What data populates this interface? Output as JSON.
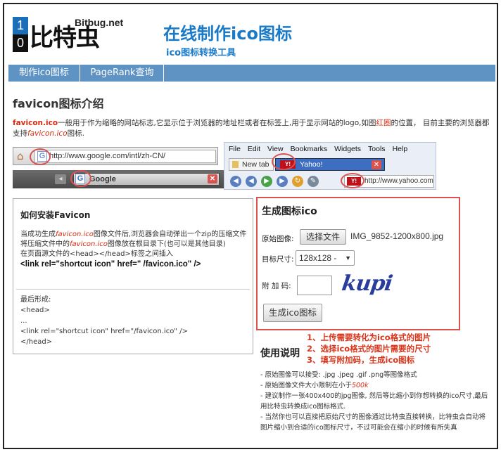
{
  "logo": {
    "digit_top": "1",
    "digit_bottom": "0",
    "text": "比特虫",
    "domain": "Bitbug.net"
  },
  "header": {
    "title": "在线制作ico图标",
    "subtitle": "ico图标转换工具"
  },
  "nav": {
    "items": [
      "制作ico图标",
      "PageRank查询"
    ]
  },
  "intro": {
    "title": "favicon图标介绍",
    "p_lead": "favicon.ico",
    "p_mid": "一般用于作为缩略的网站标志,它显示位于浏览器的地址栏或者在标签上,用于显示网站的logo,如图",
    "p_red": "红圈",
    "p_tail": "的位置， 目前主要的浏览器都支持",
    "p_ital": "favicon.ico",
    "p_end": "图标."
  },
  "browser1": {
    "url": "http://www.google.com/intl/zh-CN/",
    "tab_title": "Google",
    "g": "G"
  },
  "browser2": {
    "menu": [
      "File",
      "Edit",
      "View",
      "Bookmarks",
      "Widgets",
      "Tools",
      "Help"
    ],
    "tab1": "New tab",
    "tab2": "Yahoo!",
    "yicon": "Y!",
    "url": "http://www.yahoo.com"
  },
  "howto": {
    "title": "如何安装Favicon",
    "l1a": "当成功生成",
    "l1b": "favicon.ico",
    "l1c": "图像文件后,浏览器会自动弹出一个zip的压缩文件",
    "l2a": "将压缩文件中的",
    "l2b": "favicon.ico",
    "l2c": "图像放在根目录下(也可以是其他目录)",
    "l3": "在页面源文件的<head></head>标签之间插入",
    "code": "<link rel=\"shortcut icon\" href=\" /favicon.ico\" />",
    "r1": "最后形成:",
    "r2": "<head>",
    "r3": "...",
    "r4": "<link rel=\"shortcut icon\" href=\"/favicon.ico\" />",
    "r5": "</head>"
  },
  "generator": {
    "title": "生成图标ico",
    "label_file": "原始图像:",
    "file_button": "选择文件",
    "file_name": "IMG_9852-1200x800.jpg",
    "label_size": "目标尺寸:",
    "size_value": "128x128 -",
    "label_code": "附 加 码:",
    "captcha_text": "kupi",
    "submit": "生成ico图标"
  },
  "annotations": [
    "1、上传需要转化为ico格式的图片",
    "2、选择ico格式的图片需要的尺寸",
    "3、填写附加码，生成ico图标"
  ],
  "usage": {
    "title": "使用说明",
    "i1": "- 原始图像可以接受: .jpg .jpeg .gif .png等图像格式",
    "i2a": "- 原始图像文件大小限制在小于",
    "i2b": "500k",
    "i3": "- 建议制作一张400x400的jpg图像, 然后等比缩小到你想转换的ico尺寸,最后用比特虫转换成ico图标格式.",
    "i4": "- 当然你也可以直接把原始尺寸的图像通过比特虫直接转换，比特虫会自动将图片缩小到合适的ico图标尺寸，不过可能会在缩小的时候有所失真"
  },
  "colors": {
    "accent": "#1a7ac8",
    "nav": "#5e93c4",
    "red": "#d9534f"
  }
}
